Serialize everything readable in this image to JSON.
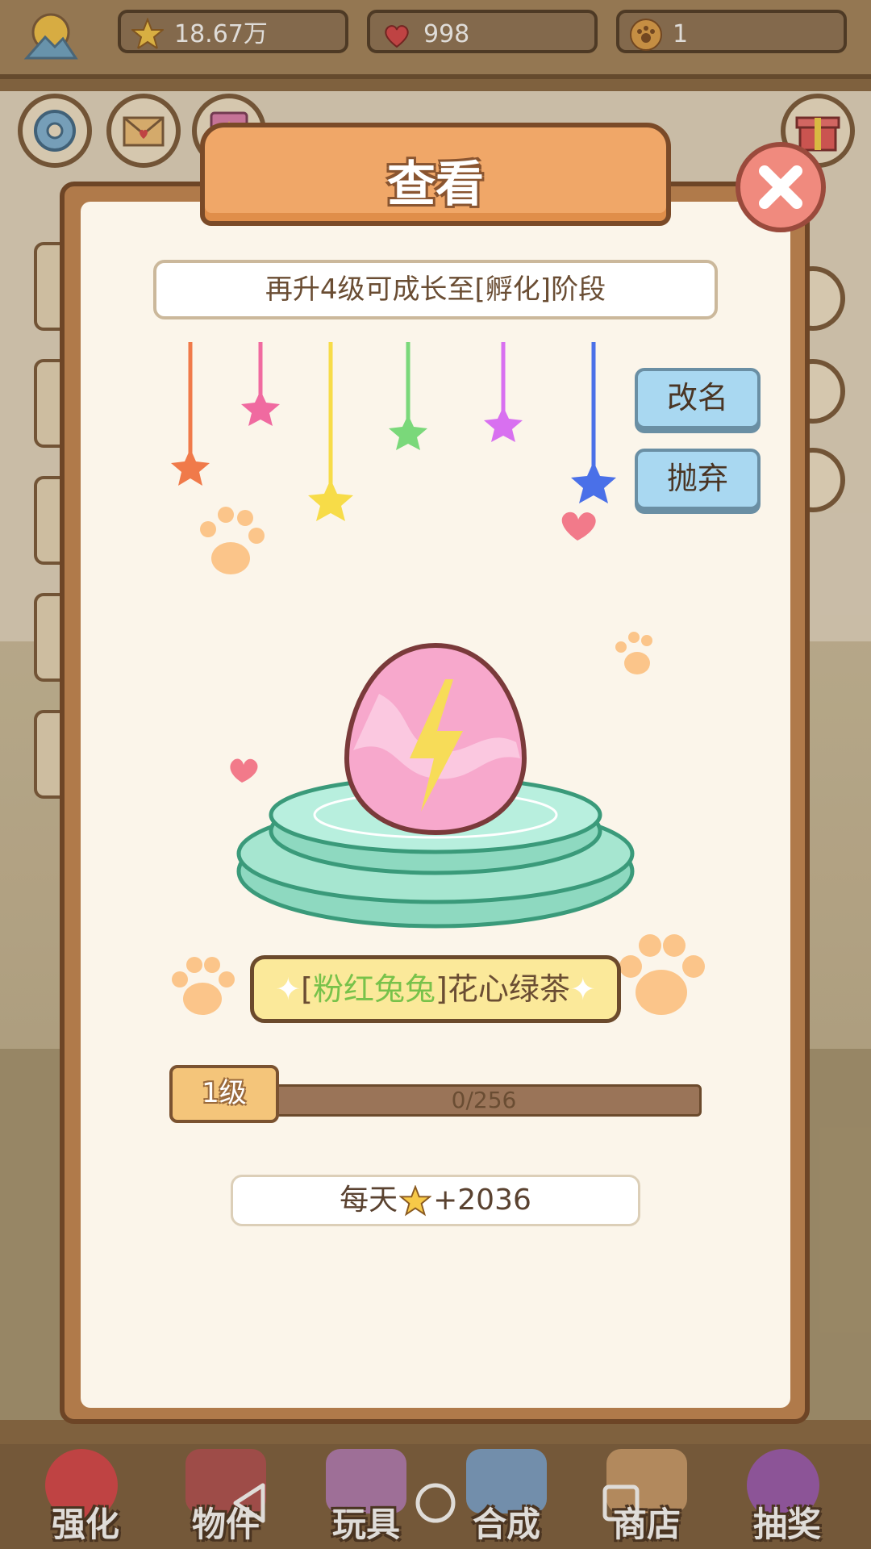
{
  "resources": {
    "stars": "18.67万",
    "hearts": "998",
    "paws": "1"
  },
  "dialog": {
    "title": "查看",
    "hint": "再升4级可成长至[孵化]阶段",
    "rename_label": "改名",
    "abandon_label": "抛弃",
    "pet_tag": "粉红兔兔",
    "pet_name": "花心绿茶",
    "level_label": "1级",
    "exp_current": 0,
    "exp_max": 256,
    "exp_text": "0/256",
    "daily_prefix": "每天",
    "daily_value": "+2036"
  },
  "bottom_nav": [
    {
      "label": "强化"
    },
    {
      "label": "物件"
    },
    {
      "label": "玩具"
    },
    {
      "label": "合成"
    },
    {
      "label": "商店"
    },
    {
      "label": "抽奖"
    }
  ],
  "colors": {
    "dialog_frame": "#b07a4a",
    "title_plate": "#f0a768",
    "action_button": "#a9d8f1",
    "pet_tag": "#78c24a"
  }
}
